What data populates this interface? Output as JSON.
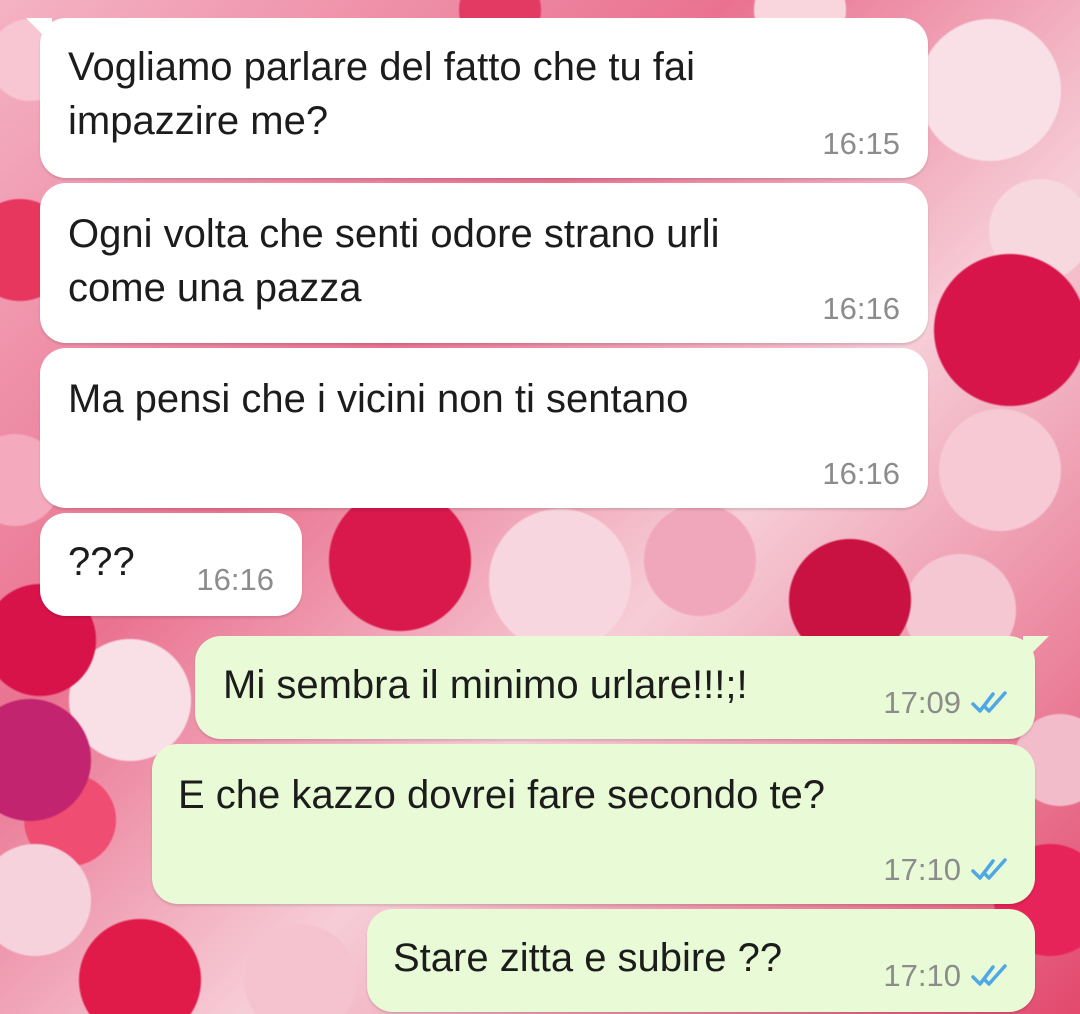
{
  "messages": [
    {
      "direction": "incoming",
      "text": "Vogliamo parlare del fatto che tu fai\nimpazzire me?",
      "time": "16:15"
    },
    {
      "direction": "incoming",
      "text": "Ogni volta che senti odore strano urli\ncome una pazza",
      "time": "16:16"
    },
    {
      "direction": "incoming",
      "text": "Ma pensi che i vicini non ti sentano",
      "time": "16:16"
    },
    {
      "direction": "incoming",
      "text": "???",
      "time": "16:16"
    },
    {
      "direction": "outgoing",
      "text": "Mi sembra il minimo urlare!!!;!",
      "time": "17:09",
      "status_icon": "double-check-icon"
    },
    {
      "direction": "outgoing",
      "text": "E che kazzo dovrei fare secondo te?",
      "time": "17:10",
      "status_icon": "double-check-icon"
    },
    {
      "direction": "outgoing",
      "text": "Stare zitta e subire ??",
      "time": "17:10",
      "status_icon": "double-check-icon"
    }
  ],
  "colors": {
    "incoming_bubble": "#ffffff",
    "outgoing_bubble": "#e9fbd6",
    "read_ticks": "#4fa7e6",
    "timestamp": "#8c8c8c"
  }
}
